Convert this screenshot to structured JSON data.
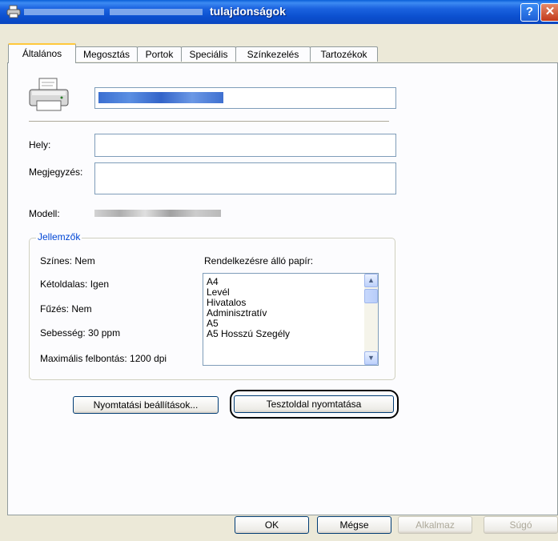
{
  "titlebar": {
    "title": "tulajdonságok",
    "help_label": "?",
    "close_label": "✕"
  },
  "tabs": [
    {
      "label": "Általános",
      "active": true
    },
    {
      "label": "Megosztás",
      "active": false
    },
    {
      "label": "Portok",
      "active": false
    },
    {
      "label": "Speciális",
      "active": false
    },
    {
      "label": "Színkezelés",
      "active": false
    },
    {
      "label": "Tartozékok",
      "active": false
    }
  ],
  "general": {
    "printer_name_value": "",
    "location_label": "Hely:",
    "location_value": "",
    "comment_label": "Megjegyzés:",
    "comment_value": "",
    "model_label": "Modell:"
  },
  "features": {
    "group_title": "Jellemzők",
    "color": "Színes: Nem",
    "duplex": "Kétoldalas: Igen",
    "stapling": "Fűzés: Nem",
    "speed": "Sebesség: 30 ppm",
    "max_resolution": "Maximális felbontás: 1200 dpi",
    "paper_label": "Rendelkezésre álló papír:",
    "paper_list": [
      "A4",
      "Levél",
      "Hivatalos",
      "Adminisztratív",
      "A5",
      "A5 Hosszú Szegély"
    ]
  },
  "buttons": {
    "print_prefs": "Nyomtatási beállítások...",
    "test_page": "Tesztoldal nyomtatása",
    "ok": "OK",
    "cancel": "Mégse",
    "apply": "Alkalmaz",
    "help": "Súgó"
  },
  "colors": {
    "titlebar": "#0b4fcf",
    "group_title": "#0046d5",
    "active_tab_accent": "#ffc83c",
    "dialog_bg": "#ece9d8"
  }
}
